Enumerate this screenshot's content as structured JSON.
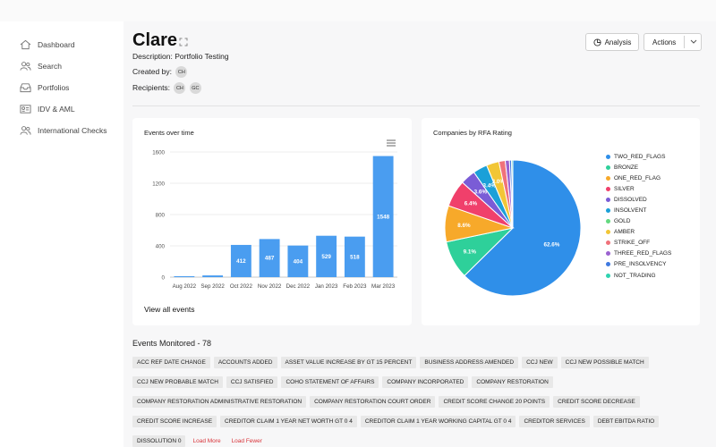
{
  "sidebar": {
    "items": [
      {
        "label": "Dashboard",
        "icon": "home-icon"
      },
      {
        "label": "Search",
        "icon": "users-icon"
      },
      {
        "label": "Portfolios",
        "icon": "inbox-icon"
      },
      {
        "label": "IDV & AML",
        "icon": "id-card-icon"
      },
      {
        "label": "International Checks",
        "icon": "users-icon"
      }
    ]
  },
  "header": {
    "title": "Clare",
    "description": "Description: Portfolio Testing",
    "created_by_label": "Created by:",
    "created_by": [
      "CH"
    ],
    "recipients_label": "Recipients:",
    "recipients": [
      "CH",
      "GC"
    ],
    "analysis_label": "Analysis",
    "actions_label": "Actions"
  },
  "events_chart": {
    "title": "Events over time",
    "link": "View all events",
    "chart_data": {
      "type": "bar",
      "categories": [
        "Aug 2022",
        "Sep 2022",
        "Oct 2022",
        "Nov 2022",
        "Dec 2022",
        "Jan 2023",
        "Feb 2023",
        "Mar 2023"
      ],
      "values": [
        12,
        22,
        412,
        487,
        404,
        529,
        518,
        1548
      ],
      "data_labels": [
        "",
        "",
        "412",
        "487",
        "404",
        "529",
        "518",
        "1548"
      ],
      "ylim": [
        0,
        1600
      ],
      "yticks": [
        0,
        400,
        800,
        1200,
        1600
      ],
      "color": "#4a9df0"
    }
  },
  "rating_chart": {
    "title": "Companies by RFA Rating",
    "chart_data": {
      "type": "pie",
      "labels": [
        "TWO_RED_FLAGS",
        "BRONZE",
        "ONE_RED_FLAG",
        "SILVER",
        "DISSOLVED",
        "INSOLVENT",
        "GOLD",
        "AMBER",
        "STRIKE_OFF",
        "THREE_RED_FLAGS",
        "PRE_INSOLVENCY",
        "NOT_TRADING"
      ],
      "colors": [
        "#2f8fe9",
        "#2ed09a",
        "#f7a92a",
        "#f0406b",
        "#7a5cd6",
        "#1ba0d8",
        "#63d97f",
        "#f2c636",
        "#f0727a",
        "#9b62d0",
        "#3f79e0",
        "#2fd3b0"
      ],
      "slices": [
        {
          "label": "TWO_RED_FLAGS",
          "value": 62.6,
          "text": "62.6%"
        },
        {
          "label": "BRONZE",
          "value": 9.1,
          "text": "9.1%"
        },
        {
          "label": "ONE_RED_FLAG",
          "value": 8.6,
          "text": "8.6%"
        },
        {
          "label": "SILVER",
          "value": 6.4,
          "text": "6.4%"
        },
        {
          "label": "DISSOLVED",
          "value": 3.6,
          "text": "3.6%"
        },
        {
          "label": "INSOLVENT",
          "value": 3.4,
          "text": "3.4%"
        },
        {
          "label": "GOLD",
          "value": 0.0,
          "text": ""
        },
        {
          "label": "AMBER",
          "value": 3.0,
          "text": "3.0%"
        },
        {
          "label": "STRIKE_OFF",
          "value": 1.5,
          "text": ""
        },
        {
          "label": "THREE_RED_FLAGS",
          "value": 1.0,
          "text": ""
        },
        {
          "label": "PRE_INSOLVENCY",
          "value": 0.5,
          "text": ""
        },
        {
          "label": "NOT_TRADING",
          "value": 0.3,
          "text": ""
        }
      ]
    }
  },
  "events_monitored": {
    "title": "Events Monitored - 78",
    "tags": [
      "ACC REF DATE CHANGE",
      "ACCOUNTS ADDED",
      "ASSET VALUE INCREASE BY GT 15 PERCENT",
      "BUSINESS ADDRESS AMENDED",
      "CCJ NEW",
      "CCJ NEW POSSIBLE MATCH",
      "CCJ NEW PROBABLE MATCH",
      "CCJ SATISFIED",
      "COHO STATEMENT OF AFFAIRS",
      "COMPANY INCORPORATED",
      "COMPANY RESTORATION",
      "COMPANY RESTORATION ADMINISTRATIVE RESTORATION",
      "COMPANY RESTORATION COURT ORDER",
      "CREDIT SCORE CHANGE 20 POINTS",
      "CREDIT SCORE DECREASE",
      "CREDIT SCORE INCREASE",
      "CREDITOR CLAIM 1 YEAR NET WORTH GT 0 4",
      "CREDITOR CLAIM 1 YEAR WORKING CAPITAL GT 0 4",
      "CREDITOR SERVICES",
      "DEBT EBITDA RATIO",
      "DISSOLUTION 0"
    ],
    "load_more": "Load More",
    "load_fewer": "Load Fewer"
  }
}
